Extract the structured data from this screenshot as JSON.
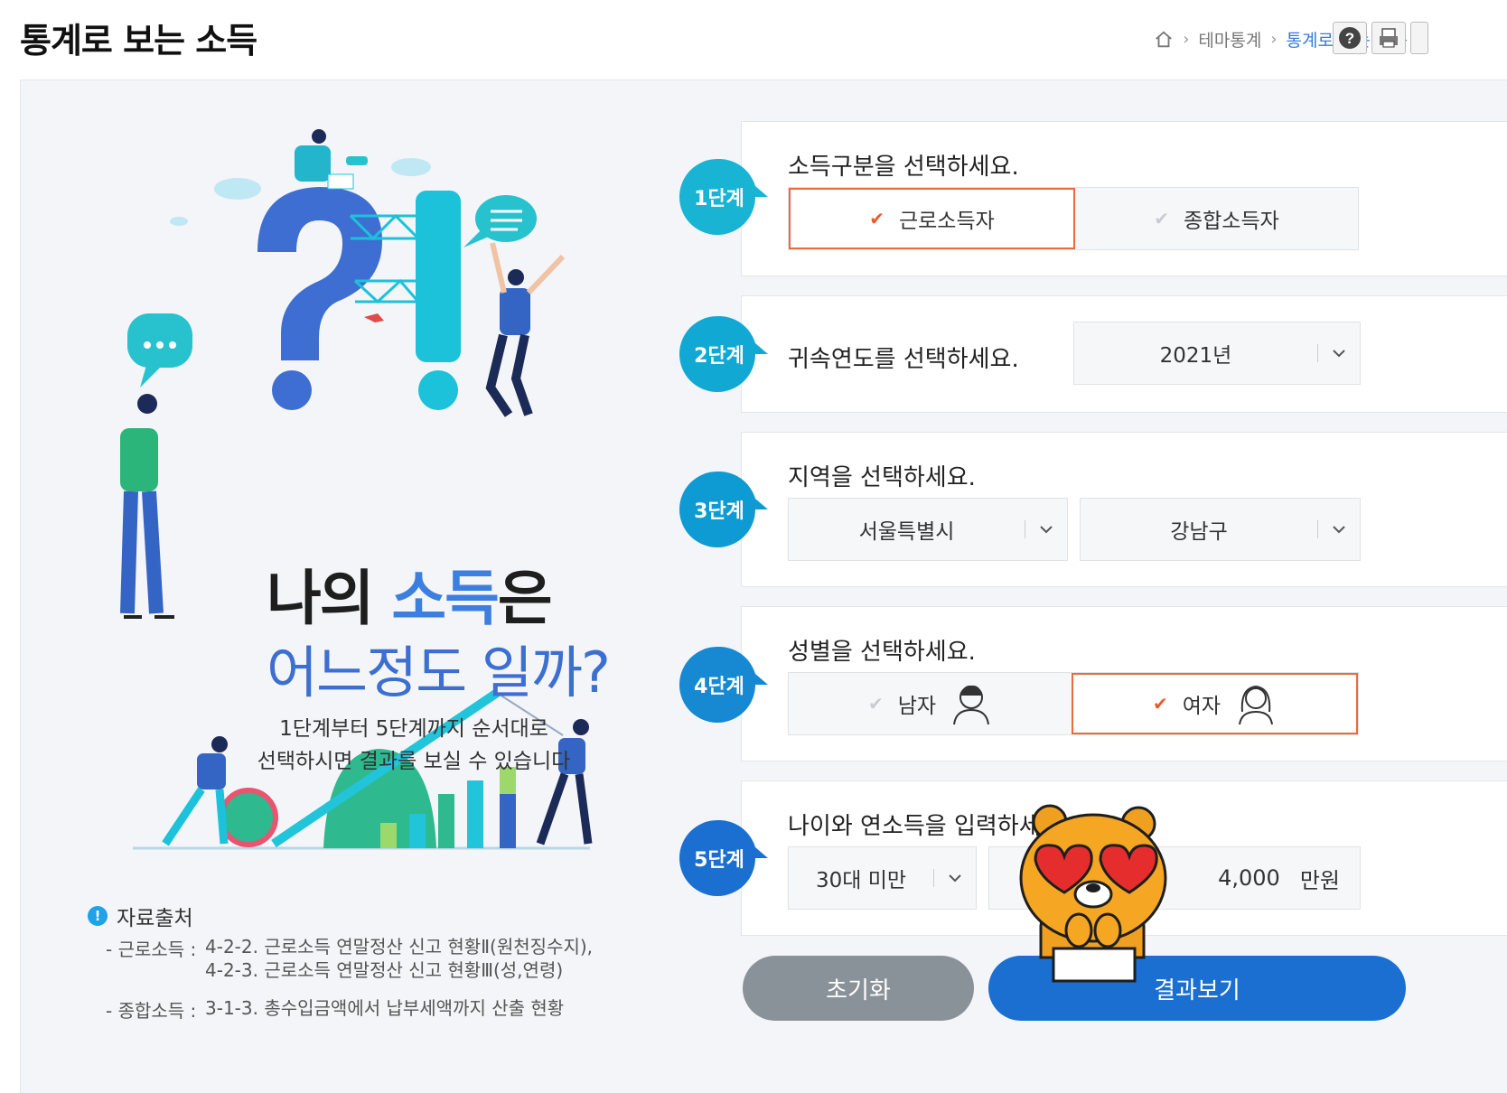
{
  "page_title": "통계로 보는 소득",
  "breadcrumb": {
    "items": [
      "테마통계",
      "통계로 보는 소득"
    ]
  },
  "toolbar": {
    "help_icon": "question-circle-icon",
    "print_icon": "printer-icon"
  },
  "hero": {
    "line1_a": "나의 ",
    "line1_accent": "소득",
    "line1_b": "은",
    "line2": "어느정도 일까?",
    "guide_1": "1단계부터 5단계까지 순서대로",
    "guide_2": "선택하시면 결과를 보실 수 있습니다"
  },
  "source": {
    "title": "자료출처",
    "rows": [
      {
        "label": "- 근로소득 :",
        "lines": [
          "4-2-2. 근로소득 연말정산 신고 현황Ⅱ(원천징수지),",
          "4-2-3. 근로소득 연말정산 신고 현황Ⅲ(성,연령)"
        ]
      },
      {
        "label": "- 종합소득 :",
        "lines": [
          "3-1-3. 총수입금액에서 납부세액까지 산출 현황"
        ]
      }
    ]
  },
  "steps": [
    {
      "badge": "1단계",
      "question": "소득구분을 선택하세요.",
      "options": [
        "근로소득자",
        "종합소득자"
      ],
      "selected": 0
    },
    {
      "badge": "2단계",
      "question": "귀속연도를 선택하세요.",
      "select_value": "2021년"
    },
    {
      "badge": "3단계",
      "question": "지역을 선택하세요.",
      "select_city": "서울특별시",
      "select_district": "강남구"
    },
    {
      "badge": "4단계",
      "question": "성별을 선택하세요.",
      "options": [
        "남자",
        "여자"
      ],
      "selected": 1
    },
    {
      "badge": "5단계",
      "question": "나이와 연소득을 입력하세요.",
      "age_select": "30대 미만",
      "income_value": "4,000",
      "income_unit": "만원"
    }
  ],
  "buttons": {
    "reset": "초기화",
    "result": "결과보기"
  },
  "colors": {
    "accent_orange": "#ec6a3c",
    "primary_blue": "#1a6fd0",
    "badge_teal": "#19b3d3",
    "reset_gray": "#8a9299"
  }
}
